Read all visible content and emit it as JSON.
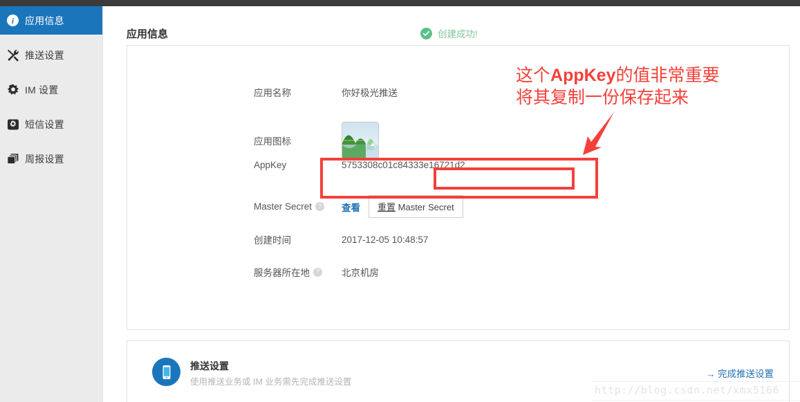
{
  "sidebar": {
    "items": [
      {
        "label": "应用信息",
        "icon": "info-icon",
        "active": true
      },
      {
        "label": "推送设置",
        "icon": "tools-icon",
        "active": false
      },
      {
        "label": "IM 设置",
        "icon": "gear-star-icon",
        "active": false
      },
      {
        "label": "短信设置",
        "icon": "gear-square-icon",
        "active": false
      },
      {
        "label": "周报设置",
        "icon": "copy-icon",
        "active": false
      }
    ]
  },
  "header": {
    "title": "应用信息",
    "toast": {
      "text": "创建成功!",
      "icon": "check-circle-icon",
      "color": "#5cc08a"
    }
  },
  "info_card": {
    "rows": [
      {
        "label": "应用名称",
        "value": "你好极光推送"
      },
      {
        "label": "应用图标",
        "value": "",
        "icon": "app-thumbnail-landscape"
      },
      {
        "label": "AppKey",
        "value": "5753308c01c84333e16721d2"
      },
      {
        "label": "Master Secret",
        "help": "?",
        "view_link": "查看",
        "reset_prefix": "重置",
        "reset_suffix": "Master Secret"
      },
      {
        "label": "创建时间",
        "value": "2017-12-05 10:48:57"
      },
      {
        "label": "服务器所在地",
        "help": "?",
        "value": "北京机房"
      }
    ]
  },
  "push_card": {
    "title": "推送设置",
    "subtitle": "使用推送业务或 IM 业务需先完成推送设置",
    "link": "→ 完成推送设置",
    "icon": "mobile-phone-icon",
    "icon_color": "#1b75bb"
  },
  "annotation": {
    "line1_a": "这个",
    "line1_b": "AppKey",
    "line1_c": "的值非常重要",
    "line2": "将其复制一份保存起来",
    "color": "#f4403a"
  },
  "watermark": {
    "text": "http://blog.csdn.net/xmx5166"
  }
}
